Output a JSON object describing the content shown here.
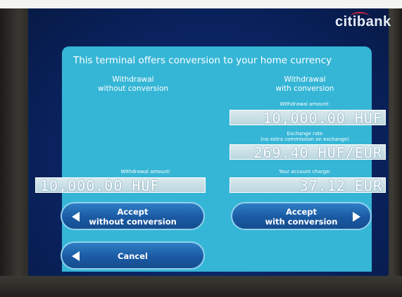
{
  "brand": "citibank",
  "title": "This terminal offers conversion to your home currency",
  "left_column": {
    "heading": "Withdrawal\nwithout conversion",
    "amount_label": "Withdrawal amount:",
    "amount_value": "10,000.00 HUF"
  },
  "right_column": {
    "heading": "Withdrawal\nwith conversion",
    "amount_label": "Withdrawal amount:",
    "amount_value": "10,000.00 HUF",
    "rate_label": "Exchange rate",
    "rate_note": "(no extra commission on exchange)",
    "rate_value": "269.40 HUF/EUR",
    "charge_label": "Your account charge:",
    "charge_value": "37.12 EUR"
  },
  "buttons": {
    "accept_without": "Accept\nwithout conversion",
    "accept_with": "Accept\nwith conversion",
    "cancel": "Cancel"
  },
  "colors": {
    "panel": "#36b6d6",
    "button": "#1a5aa3",
    "screen": "#0a2462",
    "brand_arc": "#d0273c"
  }
}
